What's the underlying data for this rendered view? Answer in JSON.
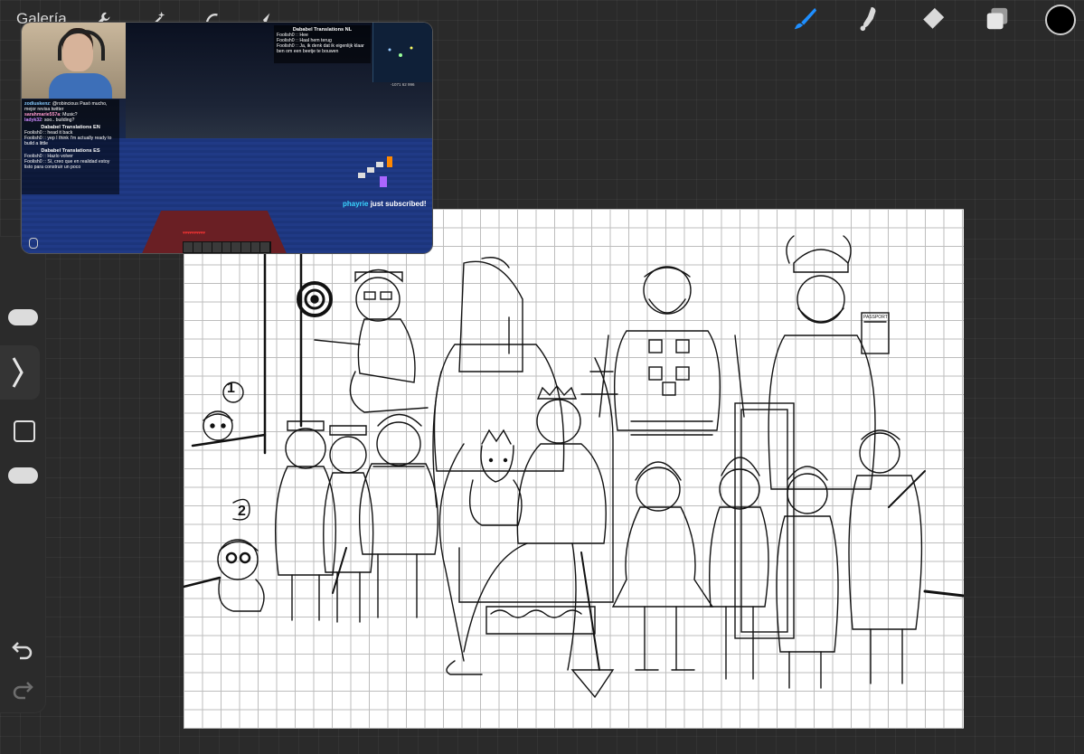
{
  "topbar": {
    "gallery_label": "Galería",
    "left_tools": [
      "wrench-icon",
      "magic-wand-icon",
      "selection-icon",
      "transform-arrow-icon"
    ],
    "right_tools": [
      "brush-icon",
      "smudge-icon",
      "eraser-icon",
      "layers-icon",
      "color-swatch"
    ],
    "accent_color": "#1f8fff",
    "active_color": "#000000"
  },
  "sidebar": {
    "size_slider_level": 0.78,
    "opacity_slider_level": 0.22,
    "undo_icon": "undo-icon",
    "redo_icon": "redo-icon"
  },
  "stream": {
    "chat_user1": "zodiuskenz",
    "chat_msg1": "@robincious Pasó mucho, mejor revisa twitter",
    "chat_user2": "sarahmarie557a",
    "chat_msg2": "Music?",
    "chat_user3": "ladyk32",
    "chat_msg3": "soo.. building?",
    "translation_title_nl": "Dababel Translations NL",
    "nl_line1": "Foolish0 :: Hee",
    "nl_line2": "Foolish0 :: Haal hem terug",
    "nl_line3": "Foolish0 :: Ja, ik denk dat ik eigenlijk klaar ben om een beetje te bouwen",
    "translation_title_en": "Dababel Translations EN",
    "en_line1": "Foolish0 :: head it back",
    "en_line2": "Foolish0 :: yep I think I'm actually ready to build a little",
    "translation_title_es": "Dababel Translations ES",
    "es_line1": "Foolish0 :: Hazlo volver",
    "es_line2": "Foolish0 :: Sí, creo que en realidad estoy listo para construir un poco",
    "coords": "-1071 62 996",
    "subscriber_name": "phayrie",
    "subscriber_text": "just subscribed!"
  },
  "canvas": {
    "annotation_1": "1",
    "annotation_2": "2",
    "sign_text": "PASSPORT"
  }
}
